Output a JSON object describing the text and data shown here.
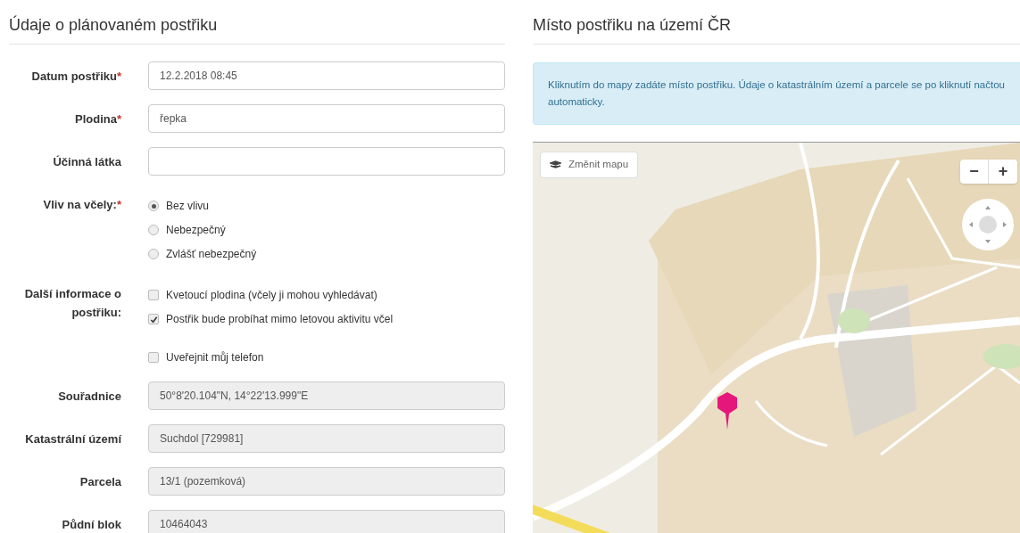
{
  "form": {
    "title": "Údaje o plánovaném postřiku",
    "rows": [
      {
        "kind": "input",
        "label": "Datum postřiku",
        "required_mark": "*",
        "value": "12.2.2018 08:45",
        "readonly": false
      },
      {
        "kind": "input",
        "label": "Plodina",
        "required_mark": "*",
        "value": "řepka",
        "readonly": false
      },
      {
        "kind": "input",
        "label": "Účinná látka",
        "readonly": false
      },
      {
        "kind": "radios",
        "label": "Vliv na včely:",
        "required_mark": "*",
        "options": [
          {
            "label": "Bez vlivu",
            "selected": true
          },
          {
            "label": "Nebezpečný",
            "selected": false
          },
          {
            "label": "Zvlášť nebezpečný",
            "selected": false
          }
        ]
      },
      {
        "kind": "checkboxes",
        "label": "Další informace o postřiku:",
        "options": [
          {
            "label": "Kvetoucí plodina (včely ji mohou vyhledávat)",
            "checked": false
          },
          {
            "label": "Postřik bude probíhat mimo letovou aktivitu včel",
            "checked": true
          }
        ]
      },
      {
        "kind": "checkboxes",
        "options": [
          {
            "label": "Uveřejnit můj telefon",
            "checked": false
          }
        ]
      },
      {
        "kind": "input",
        "label": "Souřadnice",
        "value": "50°8'20.104\"N, 14°22'13.999\"E",
        "readonly": true
      },
      {
        "kind": "input",
        "label": "Katastrální území",
        "value": "Suchdol [729981]",
        "readonly": true
      },
      {
        "kind": "input",
        "label": "Parcela",
        "value": "13/1 (pozemková)",
        "readonly": true
      },
      {
        "kind": "input",
        "label": "Půdní blok",
        "value": "10464043",
        "readonly": true
      }
    ]
  },
  "map_panel": {
    "title": "Místo postřiku na území ČR",
    "info": "Kliknutím do mapy zadáte místo postřiku. Údaje o katastrálním území a parcele se po kliknutí načtou automaticky.",
    "change_map_button": "Změnit mapu",
    "zoom_out": "−",
    "zoom_in": "+"
  }
}
